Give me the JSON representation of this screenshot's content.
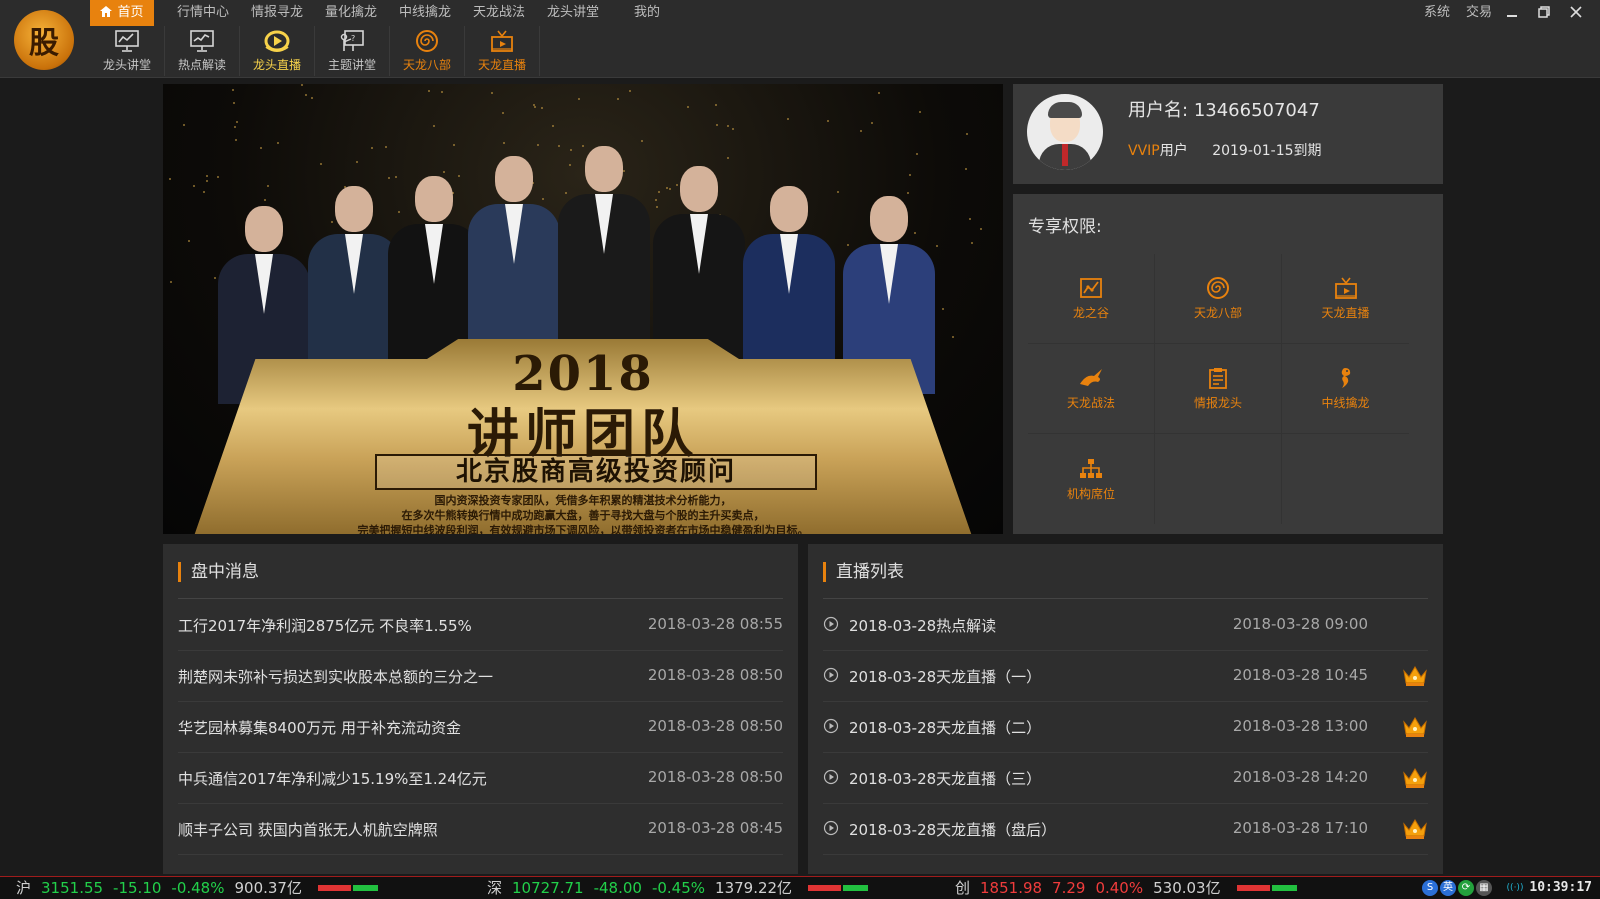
{
  "logo": {
    "char": "股"
  },
  "menu": {
    "items": [
      {
        "label": "首页",
        "active": true
      },
      {
        "label": "行情中心"
      },
      {
        "label": "情报寻龙"
      },
      {
        "label": "量化擒龙"
      },
      {
        "label": "中线擒龙"
      },
      {
        "label": "天龙战法"
      },
      {
        "label": "龙头讲堂"
      },
      {
        "label": "我的"
      }
    ],
    "system": "系统",
    "trade": "交易"
  },
  "toolbar": {
    "items": [
      {
        "label": "龙头讲堂",
        "icon": "chart-monitor-icon",
        "color": "#c7c7c7"
      },
      {
        "label": "热点解读",
        "icon": "trend-monitor-icon",
        "color": "#c7c7c7"
      },
      {
        "label": "龙头直播",
        "icon": "play-circle-icon",
        "color": "#f7d24a"
      },
      {
        "label": "主题讲堂",
        "icon": "board-teacher-icon",
        "color": "#c7c7c7"
      },
      {
        "label": "天龙八部",
        "icon": "spiral-icon",
        "color": "#e8820e"
      },
      {
        "label": "天龙直播",
        "icon": "tv-icon",
        "color": "#e8820e"
      }
    ]
  },
  "banner": {
    "year": "2018",
    "title": "讲师团队",
    "subtitle": "北京股商高级投资顾问",
    "desc": [
      "国内资深投资专家团队，凭借多年积累的精湛技术分析能力，",
      "在多次牛熊转换行情中成功跑赢大盘，善于寻找大盘与个股的主升买卖点，",
      "完美把握短中线波段利润，有效规避市场下调风险，以带领投资者在市场中稳健盈利为目标。"
    ]
  },
  "user": {
    "name_label": "用户名:",
    "name": "13466507047",
    "level": "VVIP",
    "level_suffix": "用户",
    "expire": "2019-01-15到期"
  },
  "privileges": {
    "title": "专享权限:",
    "items": [
      {
        "label": "龙之谷",
        "icon": "chart-box-icon"
      },
      {
        "label": "天龙八部",
        "icon": "spiral-icon"
      },
      {
        "label": "天龙直播",
        "icon": "tv-icon"
      },
      {
        "label": "天龙战法",
        "icon": "dragon-icon"
      },
      {
        "label": "情报龙头",
        "icon": "clipboard-icon"
      },
      {
        "label": "中线擒龙",
        "icon": "seahorse-icon"
      },
      {
        "label": "机构席位",
        "icon": "org-chart-icon"
      }
    ]
  },
  "news": {
    "title": "盘中消息",
    "rows": [
      {
        "title": "工行2017年净利润2875亿元 不良率1.55%",
        "time": "2018-03-28 08:55"
      },
      {
        "title": "荆楚网未弥补亏损达到实收股本总额的三分之一",
        "time": "2018-03-28 08:50"
      },
      {
        "title": "华艺园林募集8400万元 用于补充流动资金",
        "time": "2018-03-28 08:50"
      },
      {
        "title": "中兵通信2017年净利减少15.19%至1.24亿元",
        "time": "2018-03-28 08:50"
      },
      {
        "title": "顺丰子公司 获国内首张无人机航空牌照",
        "time": "2018-03-28 08:45"
      }
    ]
  },
  "live": {
    "title": "直播列表",
    "rows": [
      {
        "title": "2018-03-28热点解读",
        "time": "2018-03-28 09:00",
        "vip": false
      },
      {
        "title": "2018-03-28天龙直播（一）",
        "time": "2018-03-28 10:45",
        "vip": true
      },
      {
        "title": "2018-03-28天龙直播（二）",
        "time": "2018-03-28 13:00",
        "vip": true
      },
      {
        "title": "2018-03-28天龙直播（三）",
        "time": "2018-03-28 14:20",
        "vip": true
      },
      {
        "title": "2018-03-28天龙直播（盘后）",
        "time": "2018-03-28 17:10",
        "vip": true
      }
    ]
  },
  "status": {
    "indices": [
      {
        "name": "沪",
        "price": "3151.55",
        "change": "-15.10",
        "pct": "-0.48%",
        "amount": "900.37亿",
        "dir": "down"
      },
      {
        "name": "深",
        "price": "10727.71",
        "change": "-48.00",
        "pct": "-0.45%",
        "amount": "1379.22亿",
        "dir": "down"
      },
      {
        "name": "创",
        "price": "1851.98",
        "change": "7.29",
        "pct": "0.40%",
        "amount": "530.03亿",
        "dir": "up"
      }
    ],
    "icons": [
      {
        "name": "s-icon",
        "glyph": "S",
        "color": "#2b6fd6"
      },
      {
        "name": "ying-icon",
        "glyph": "英",
        "color": "#2b6fd6"
      },
      {
        "name": "refresh-icon",
        "glyph": "⟳",
        "color": "#23a13c"
      },
      {
        "name": "grid-icon",
        "glyph": "▦",
        "color": "#555"
      },
      {
        "name": "wifi-icon",
        "glyph": "((·))",
        "color": "transparent"
      }
    ],
    "clock": "10:39:17"
  },
  "colors": {
    "accent": "#e8820e",
    "bg": "#1b1b1b",
    "panel": "#3a3a3a",
    "up": "#f03c3c",
    "down": "#22d04a"
  }
}
